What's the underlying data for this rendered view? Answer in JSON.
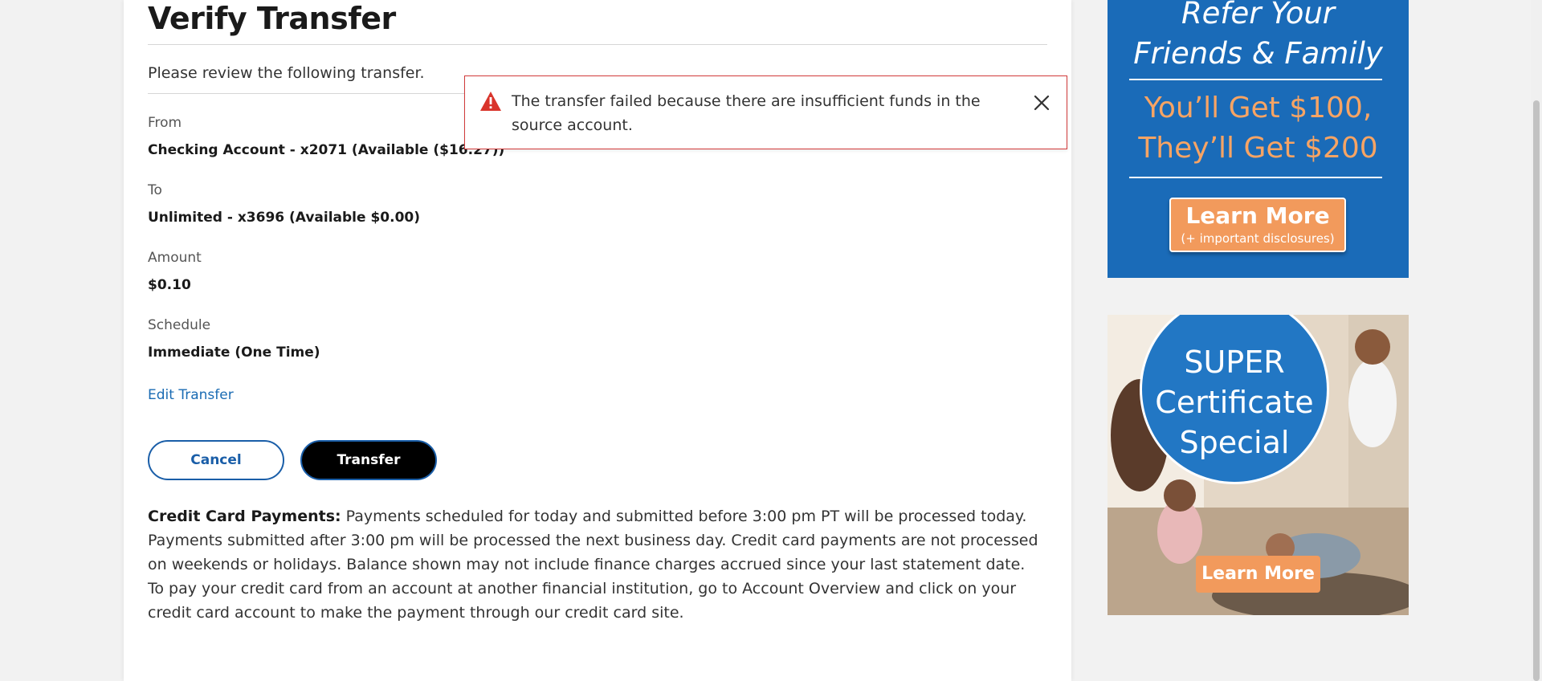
{
  "page": {
    "title": "Verify Transfer",
    "review_text": "Please review the following transfer."
  },
  "transfer": {
    "from_label": "From",
    "from_value": "Checking Account - x2071 (Available  ($16.27))",
    "to_label": "To",
    "to_value": "Unlimited - x3696 (Available  $0.00)",
    "amount_label": "Amount",
    "amount_value": "$0.10",
    "schedule_label": "Schedule",
    "schedule_value": "Immediate (One Time)",
    "edit_link": "Edit Transfer"
  },
  "buttons": {
    "cancel": "Cancel",
    "transfer": "Transfer"
  },
  "info": {
    "cc_heading": "Credit Card Payments:",
    "cc_body": " Payments scheduled for today and submitted before 3:00 pm PT will be processed today. Payments submitted after 3:00 pm will be processed the next business day. Credit card payments are not processed on weekends or holidays. Balance shown may not include finance charges accrued since your last statement date.",
    "cc_other": "To pay your credit card from an account at another financial institution, go to Account Overview and click on your credit card account to make the payment through our credit card site."
  },
  "alert": {
    "message": "The transfer failed because there are insufficient funds in the source account.",
    "icon": "warning-triangle-icon",
    "close_icon": "close-icon",
    "border_color": "#d13a3a"
  },
  "ads": {
    "referral": {
      "title_line1": "Refer Your",
      "title_line2": "Friends & Family",
      "offer_line1": "You’ll Get $100,",
      "offer_line2": "They’ll Get $200",
      "button_main": "Learn More",
      "button_sub": "(+ important disclosures)"
    },
    "super": {
      "line1": "SUPER",
      "line2": "Certificate",
      "line3": "Special",
      "button": "Learn More"
    }
  },
  "colors": {
    "brand_blue": "#1a6bb8",
    "accent_orange": "#f29a5c",
    "link_blue": "#1a6bb3"
  }
}
